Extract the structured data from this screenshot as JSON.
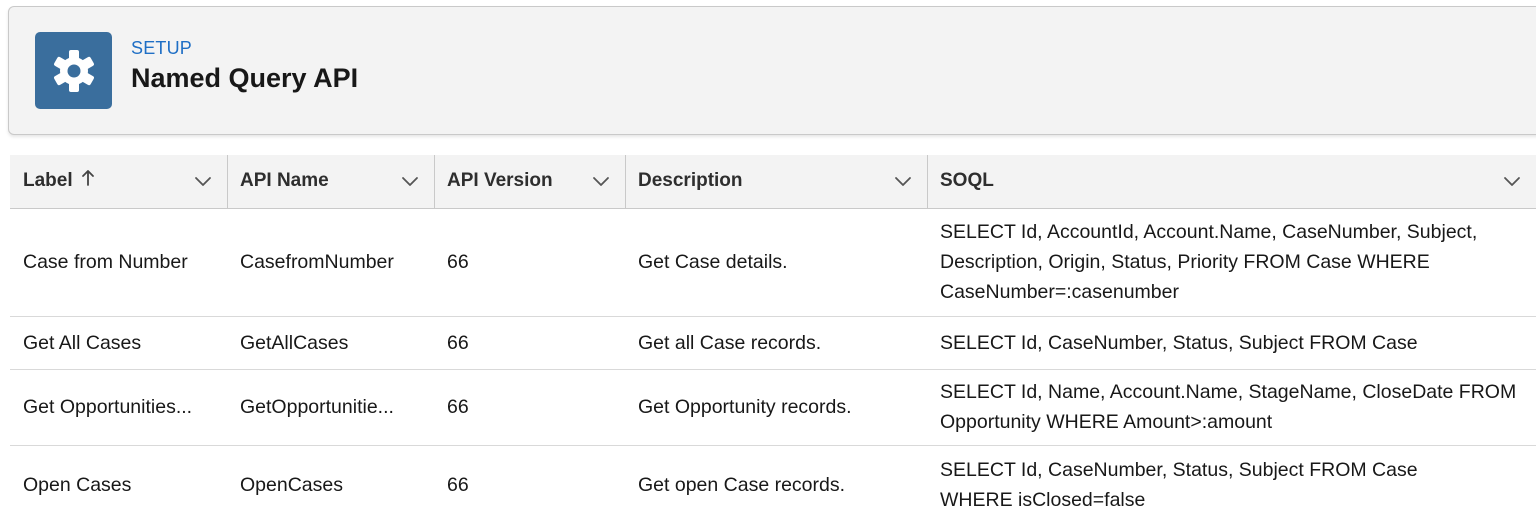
{
  "header": {
    "eyebrow": "SETUP",
    "title": "Named Query API",
    "icon": "gear-icon",
    "icon_bg": "#3a6e9d"
  },
  "table": {
    "columns": [
      {
        "label": "Label",
        "sort": "ascending"
      },
      {
        "label": "API Name"
      },
      {
        "label": "API Version"
      },
      {
        "label": "Description"
      },
      {
        "label": "SOQL"
      }
    ],
    "rows": [
      {
        "label": "Case from Number",
        "api_name": "CasefromNumber",
        "api_version": "66",
        "description": "Get Case details.",
        "soql": "SELECT Id, AccountId, Account.Name, CaseNumber, Subject, Description, Origin, Status, Priority FROM Case WHERE CaseNumber=:casenumber"
      },
      {
        "label": "Get All Cases",
        "api_name": "GetAllCases",
        "api_version": "66",
        "description": "Get all Case records.",
        "soql": "SELECT Id, CaseNumber, Status, Subject FROM Case"
      },
      {
        "label": "Get Opportunities...",
        "api_name": "GetOpportunitie...",
        "api_version": "66",
        "description": "Get Opportunity records.",
        "soql": "SELECT Id, Name, Account.Name, StageName, CloseDate FROM Opportunity WHERE Amount>:amount"
      },
      {
        "label": "Open Cases",
        "api_name": "OpenCases",
        "api_version": "66",
        "description": "Get open Case records.",
        "soql": "SELECT Id, CaseNumber, Status, Subject FROM Case WHERE isClosed=false"
      }
    ]
  }
}
